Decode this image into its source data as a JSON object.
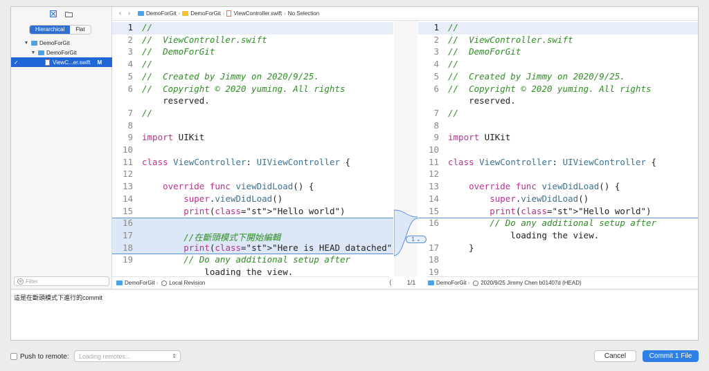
{
  "sidebar": {
    "segment": {
      "hier": "Hierarchical",
      "flat": "Flat"
    },
    "tree": {
      "root": "DemoForGit",
      "folder": "DemoForGit",
      "file": "ViewC...er.swift",
      "file_status": "M",
      "checkmark": "✓"
    },
    "filter_placeholder": "Filter"
  },
  "breadcrumb": {
    "project": "DemoForGit",
    "group": "DemoForGit",
    "file": "ViewController.swift",
    "selection": "No Selection"
  },
  "left_lines": [
    {
      "n": "1",
      "t": "//"
    },
    {
      "n": "2",
      "t": "//  ViewController.swift"
    },
    {
      "n": "3",
      "t": "//  DemoForGit"
    },
    {
      "n": "4",
      "t": "//"
    },
    {
      "n": "5",
      "t": "//  Created by Jimmy on 2020/9/25."
    },
    {
      "n": "6",
      "t": "//  Copyright © 2020 yuming. All rights"
    },
    {
      "n": "",
      "t": "    reserved."
    },
    {
      "n": "7",
      "t": "//"
    },
    {
      "n": "8",
      "t": ""
    },
    {
      "n": "9",
      "t": "import UIKit"
    },
    {
      "n": "10",
      "t": ""
    },
    {
      "n": "11",
      "t": "class ViewController: UIViewController {"
    },
    {
      "n": "12",
      "t": ""
    },
    {
      "n": "13",
      "t": "    override func viewDidLoad() {"
    },
    {
      "n": "14",
      "t": "        super.viewDidLoad()"
    },
    {
      "n": "15",
      "t": "        print(\"Hello world\")"
    },
    {
      "n": "16",
      "t": ""
    },
    {
      "n": "17",
      "t": "        //在斷頭模式下開始編輯"
    },
    {
      "n": "18",
      "t": "        print(\"Here is HEAD datached\")"
    },
    {
      "n": "19",
      "t": "        // Do any additional setup after"
    },
    {
      "n": "",
      "t": "            loading the view."
    }
  ],
  "right_lines": [
    {
      "n": "1",
      "t": "//"
    },
    {
      "n": "2",
      "t": "//  ViewController.swift"
    },
    {
      "n": "3",
      "t": "//  DemoForGit"
    },
    {
      "n": "4",
      "t": "//"
    },
    {
      "n": "5",
      "t": "//  Created by Jimmy on 2020/9/25."
    },
    {
      "n": "6",
      "t": "//  Copyright © 2020 yuming. All rights"
    },
    {
      "n": "",
      "t": "    reserved."
    },
    {
      "n": "7",
      "t": "//"
    },
    {
      "n": "8",
      "t": ""
    },
    {
      "n": "9",
      "t": "import UIKit"
    },
    {
      "n": "10",
      "t": ""
    },
    {
      "n": "11",
      "t": "class ViewController: UIViewController {"
    },
    {
      "n": "12",
      "t": ""
    },
    {
      "n": "13",
      "t": "    override func viewDidLoad() {"
    },
    {
      "n": "14",
      "t": "        super.viewDidLoad()"
    },
    {
      "n": "15",
      "t": "        print(\"Hello world\")"
    },
    {
      "n": "16",
      "t": "        // Do any additional setup after"
    },
    {
      "n": "",
      "t": "            loading the view."
    },
    {
      "n": "17",
      "t": "    }"
    },
    {
      "n": "18",
      "t": ""
    },
    {
      "n": "19",
      "t": ""
    }
  ],
  "change_badge": "1 ⌄",
  "left_header": {
    "project": "DemoForGit",
    "revision": "Local Revision"
  },
  "pager": {
    "prev": "⟨",
    "label": "1/1",
    "next": "⟩"
  },
  "right_header": {
    "project": "DemoForGit",
    "revision": "2020/9/25  Jimmy Chen  b01407d (HEAD)"
  },
  "commit_message": "這是在斷頭模式下進行的commit",
  "push": {
    "label": "Push to remote:",
    "placeholder": "Loading remotes..."
  },
  "buttons": {
    "cancel": "Cancel",
    "commit": "Commit 1 File"
  }
}
